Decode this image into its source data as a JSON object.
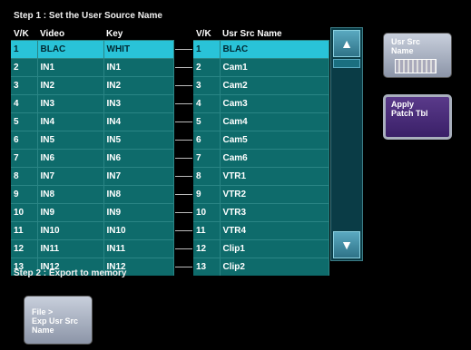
{
  "step1": "Step 1 : Set the User Source Name",
  "step2": "Step 2 : Export to memory",
  "left_headers": [
    "V/K",
    "Video",
    "Key"
  ],
  "right_headers": [
    "V/K",
    "Usr Src Name"
  ],
  "left_rows": [
    [
      "1",
      "BLAC",
      "WHIT"
    ],
    [
      "2",
      "IN1",
      "IN1"
    ],
    [
      "3",
      "IN2",
      "IN2"
    ],
    [
      "4",
      "IN3",
      "IN3"
    ],
    [
      "5",
      "IN4",
      "IN4"
    ],
    [
      "6",
      "IN5",
      "IN5"
    ],
    [
      "7",
      "IN6",
      "IN6"
    ],
    [
      "8",
      "IN7",
      "IN7"
    ],
    [
      "9",
      "IN8",
      "IN8"
    ],
    [
      "10",
      "IN9",
      "IN9"
    ],
    [
      "11",
      "IN10",
      "IN10"
    ],
    [
      "12",
      "IN11",
      "IN11"
    ],
    [
      "13",
      "IN12",
      "IN12"
    ]
  ],
  "right_rows": [
    [
      "1",
      "BLAC"
    ],
    [
      "2",
      "Cam1"
    ],
    [
      "3",
      "Cam2"
    ],
    [
      "4",
      "Cam3"
    ],
    [
      "5",
      "Cam4"
    ],
    [
      "6",
      "Cam5"
    ],
    [
      "7",
      "Cam6"
    ],
    [
      "8",
      "VTR1"
    ],
    [
      "9",
      "VTR2"
    ],
    [
      "10",
      "VTR3"
    ],
    [
      "11",
      "VTR4"
    ],
    [
      "12",
      "Clip1"
    ],
    [
      "13",
      "Clip2"
    ]
  ],
  "selected_row": 0,
  "scroll_up_icon": "arrow-up-icon",
  "scroll_down_icon": "arrow-down-icon",
  "buttons": {
    "usr_src_line1": "Usr Src",
    "usr_src_line2": "Name",
    "apply_line1": "Apply",
    "apply_line2": "Patch Tbl",
    "export_line1": "File >",
    "export_line2": "Exp Usr Src",
    "export_line3": "Name"
  },
  "colors": {
    "row_bg": "#0e6b6b",
    "selected_bg": "#29c3d8",
    "background": "#000000"
  }
}
